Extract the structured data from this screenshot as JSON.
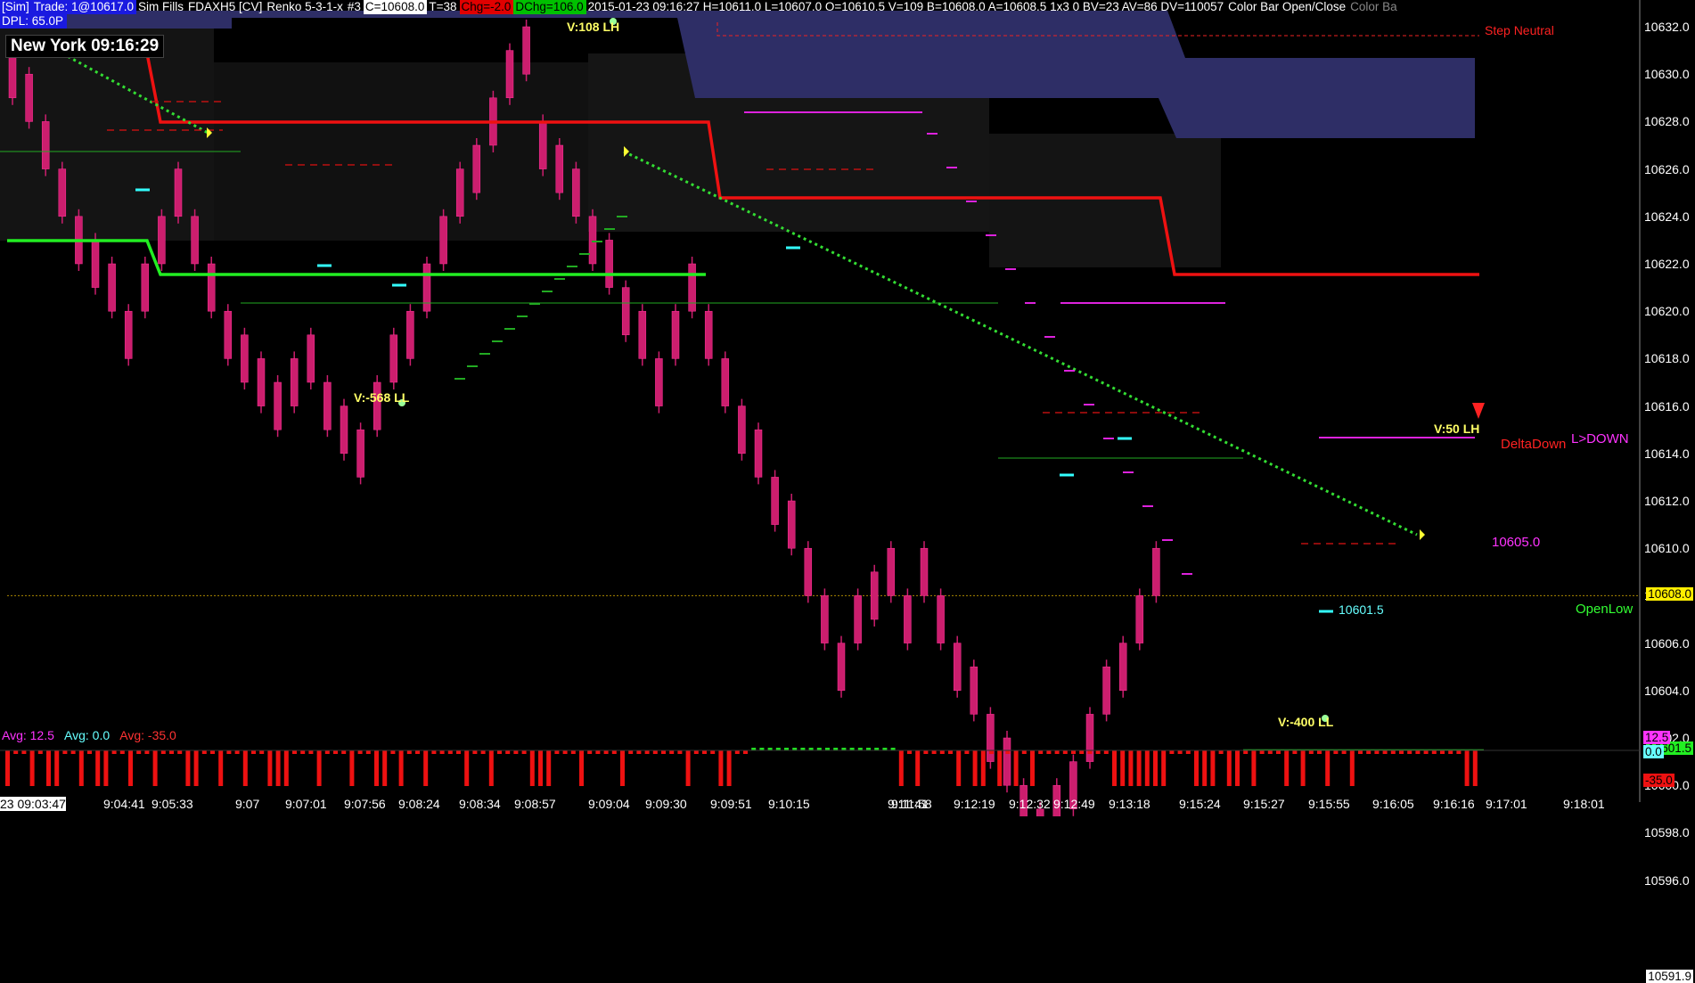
{
  "header": {
    "account": "[Sim]",
    "trade": "Trade: 1@10617.0",
    "fills": "Sim Fills",
    "instrument": "FDAXH5 [CV]",
    "chart_type": "Renko 5-3-1-x",
    "tab": "#3",
    "close": "C=10608.0",
    "ticks": "T=38",
    "chg": "Chg=-2.0",
    "dchg": "DChg=106.0",
    "stats": "2015-01-23 09:16:27 H=10611.0 L=10607.0 O=10610.5 V=109 B=10608.0 A=10608.5 1x3 0 BV=23 AV=86 DV=110057",
    "color_bar": "Color Bar Open/Close",
    "color_ba": "Color Ba",
    "dpl": "DPL: 65.0P"
  },
  "clock": "New York 09:16:29",
  "avg_panel": {
    "magenta": "Avg: 12.5",
    "cyan": "Avg: 0.0",
    "red": "Avg: -35.0",
    "values": [
      "12.5",
      "0.0",
      "-35.0"
    ]
  },
  "chart_annotations": {
    "step_neutral": "Step Neutral",
    "delta_down": "DeltaDown",
    "l_down": "L>DOWN",
    "open_low": "OpenLow",
    "v1": "V:108 LH",
    "v2": "V:-568 LL",
    "v3": "V:-400 LL",
    "v4": "V:50 LH",
    "level_10605": "10605.0",
    "level_10601": "10601.5"
  },
  "price_axis": {
    "ticks": [
      "10632.0",
      "10630.0",
      "10628.0",
      "10626.0",
      "10624.0",
      "10622.0",
      "10620.0",
      "10618.0",
      "10616.0",
      "10614.0",
      "10612.0",
      "10610.0",
      "10608.0",
      "10606.0",
      "10604.0",
      "10602.0",
      "10600.0",
      "10598.0",
      "10596.0"
    ],
    "current": "10608.0",
    "openlow": "10601.5",
    "lowest": "10591.9"
  },
  "time_axis": {
    "ticks": [
      "23 09:03:47",
      "9:04:41",
      "9:05:33",
      "9:07",
      "9:07:01",
      "9:07:56",
      "9:08:24",
      "9:08:34",
      "9:08:57",
      "9:09:04",
      "9:09:30",
      "9:09:51",
      "9:10:15",
      "9:11:41",
      "9:11:58",
      "9:12:19",
      "9:12:32",
      "9:12:49",
      "9:13:18",
      "9:15:24",
      "9:15:27",
      "9:15:55",
      "9:16:05",
      "9:16:16",
      "9:17:01",
      "9:18:01"
    ],
    "first_prefix": "4",
    "last_fragment": "16"
  },
  "chart_data": {
    "type": "candlestick",
    "ylim": [
      10591.9,
      10633.0
    ],
    "colors": {
      "bar": "#cc1e6e",
      "upper_band": "#2e2e66",
      "red_line": "#ee1111",
      "green_line": "#22ee22",
      "trend": "#33dd33"
    },
    "bricks": [
      {
        "o": 10629,
        "c": 10631,
        "l": 10630
      },
      {
        "o": 10628,
        "c": 10630,
        "l": 10630
      },
      {
        "o": 10626,
        "c": 10628,
        "l": 10628
      },
      {
        "o": 10624,
        "c": 10626,
        "l": 10626
      },
      {
        "o": 10622,
        "c": 10624,
        "l": 10624
      },
      {
        "o": 10621,
        "c": 10623,
        "l": 10623
      },
      {
        "o": 10620,
        "c": 10622,
        "l": 10622
      },
      {
        "o": 10618,
        "c": 10620,
        "l": 10620
      },
      {
        "o": 10620,
        "c": 10622,
        "l": 10622
      },
      {
        "o": 10622,
        "c": 10624,
        "l": 10624
      },
      {
        "o": 10624,
        "c": 10626,
        "l": 10626
      },
      {
        "o": 10622,
        "c": 10624,
        "l": 10624
      },
      {
        "o": 10620,
        "c": 10622,
        "l": 10622
      },
      {
        "o": 10618,
        "c": 10620,
        "l": 10620
      },
      {
        "o": 10617,
        "c": 10619,
        "l": 10619
      },
      {
        "o": 10616,
        "c": 10618,
        "l": 10618
      },
      {
        "o": 10615,
        "c": 10617,
        "l": 10617
      },
      {
        "o": 10616,
        "c": 10618,
        "l": 10618
      },
      {
        "o": 10617,
        "c": 10619,
        "l": 10619
      },
      {
        "o": 10615,
        "c": 10617,
        "l": 10617
      },
      {
        "o": 10614,
        "c": 10616,
        "l": 10616
      },
      {
        "o": 10613,
        "c": 10615,
        "l": 10615
      },
      {
        "o": 10615,
        "c": 10617,
        "l": 10617
      },
      {
        "o": 10617,
        "c": 10619,
        "l": 10619
      },
      {
        "o": 10618,
        "c": 10620,
        "l": 10620
      },
      {
        "o": 10620,
        "c": 10622,
        "l": 10622
      },
      {
        "o": 10622,
        "c": 10624,
        "l": 10624
      },
      {
        "o": 10624,
        "c": 10626,
        "l": 10626
      },
      {
        "o": 10625,
        "c": 10627,
        "l": 10627
      },
      {
        "o": 10627,
        "c": 10629,
        "l": 10629
      },
      {
        "o": 10629,
        "c": 10631,
        "l": 10631
      },
      {
        "o": 10630,
        "c": 10632,
        "l": 10632
      },
      {
        "o": 10626,
        "c": 10628,
        "l": 10628
      },
      {
        "o": 10625,
        "c": 10627,
        "l": 10627
      },
      {
        "o": 10624,
        "c": 10626,
        "l": 10626
      },
      {
        "o": 10622,
        "c": 10624,
        "l": 10624
      },
      {
        "o": 10621,
        "c": 10623,
        "l": 10623
      },
      {
        "o": 10619,
        "c": 10621,
        "l": 10621
      },
      {
        "o": 10618,
        "c": 10620,
        "l": 10620
      },
      {
        "o": 10616,
        "c": 10618,
        "l": 10618
      },
      {
        "o": 10618,
        "c": 10620,
        "l": 10620
      },
      {
        "o": 10620,
        "c": 10622,
        "l": 10622
      },
      {
        "o": 10618,
        "c": 10620,
        "l": 10620
      },
      {
        "o": 10616,
        "c": 10618,
        "l": 10618
      },
      {
        "o": 10614,
        "c": 10616,
        "l": 10616
      },
      {
        "o": 10613,
        "c": 10615,
        "l": 10615
      },
      {
        "o": 10611,
        "c": 10613,
        "l": 10613
      },
      {
        "o": 10610,
        "c": 10612,
        "l": 10612
      },
      {
        "o": 10608,
        "c": 10610,
        "l": 10610
      },
      {
        "o": 10606,
        "c": 10608,
        "l": 10608
      },
      {
        "o": 10604,
        "c": 10606,
        "l": 10606
      },
      {
        "o": 10606,
        "c": 10608,
        "l": 10608
      },
      {
        "o": 10607,
        "c": 10609,
        "l": 10609
      },
      {
        "o": 10608,
        "c": 10610,
        "l": 10610
      },
      {
        "o": 10606,
        "c": 10608,
        "l": 10608
      },
      {
        "o": 10608,
        "c": 10610,
        "l": 10610
      },
      {
        "o": 10606,
        "c": 10608,
        "l": 10608
      },
      {
        "o": 10604,
        "c": 10606,
        "l": 10606
      },
      {
        "o": 10603,
        "c": 10605,
        "l": 10605
      },
      {
        "o": 10601,
        "c": 10603,
        "l": 10603
      },
      {
        "o": 10600,
        "c": 10602,
        "l": 10602
      },
      {
        "o": 10598,
        "c": 10600,
        "l": 10600
      },
      {
        "o": 10597,
        "c": 10599,
        "l": 10599
      },
      {
        "o": 10598,
        "c": 10600,
        "l": 10600
      },
      {
        "o": 10599,
        "c": 10601,
        "l": 10601
      },
      {
        "o": 10601,
        "c": 10603,
        "l": 10603
      },
      {
        "o": 10603,
        "c": 10605,
        "l": 10605
      },
      {
        "o": 10604,
        "c": 10606,
        "l": 10606
      },
      {
        "o": 10606,
        "c": 10608,
        "l": 10608
      },
      {
        "o": 10608,
        "c": 10610,
        "l": 10610
      }
    ]
  }
}
